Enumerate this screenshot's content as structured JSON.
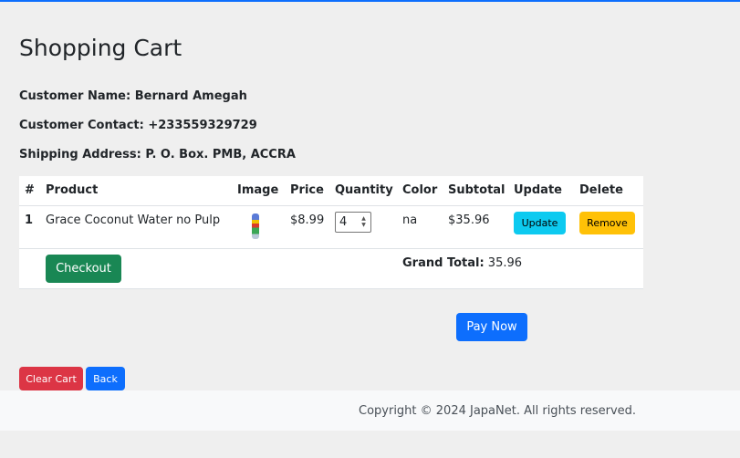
{
  "page": {
    "title": "Shopping Cart",
    "customer_name": "Customer Name: Bernard Amegah",
    "customer_contact": "Customer Contact: +233559329729",
    "shipping_address": "Shipping Address: P. O. Box. PMB, ACCRA"
  },
  "table": {
    "headers": [
      "#",
      "Product",
      "Image",
      "Price",
      "Quantity",
      "Color",
      "Subtotal",
      "Update",
      "Delete"
    ],
    "rows": [
      {
        "index": "1",
        "product": "Grace Coconut Water no Pulp",
        "image_icon": "product-thumbnail",
        "price": "$8.99",
        "quantity": "4",
        "color": "na",
        "subtotal": "$35.96",
        "update_label": "Update",
        "remove_label": "Remove"
      }
    ]
  },
  "summary": {
    "checkout_label": "Checkout",
    "grand_total_label": "Grand Total:",
    "grand_total_value": "35.96"
  },
  "actions": {
    "pay_now_label": "Pay Now",
    "clear_cart_label": "Clear Cart",
    "back_label": "Back"
  },
  "footer": {
    "copyright": "Copyright © 2024 JapaNet. All rights reserved."
  },
  "colors": {
    "primary": "#0d6efd",
    "success": "#198754",
    "info": "#0dcaf0",
    "warning": "#ffc107",
    "danger": "#dc3545"
  }
}
